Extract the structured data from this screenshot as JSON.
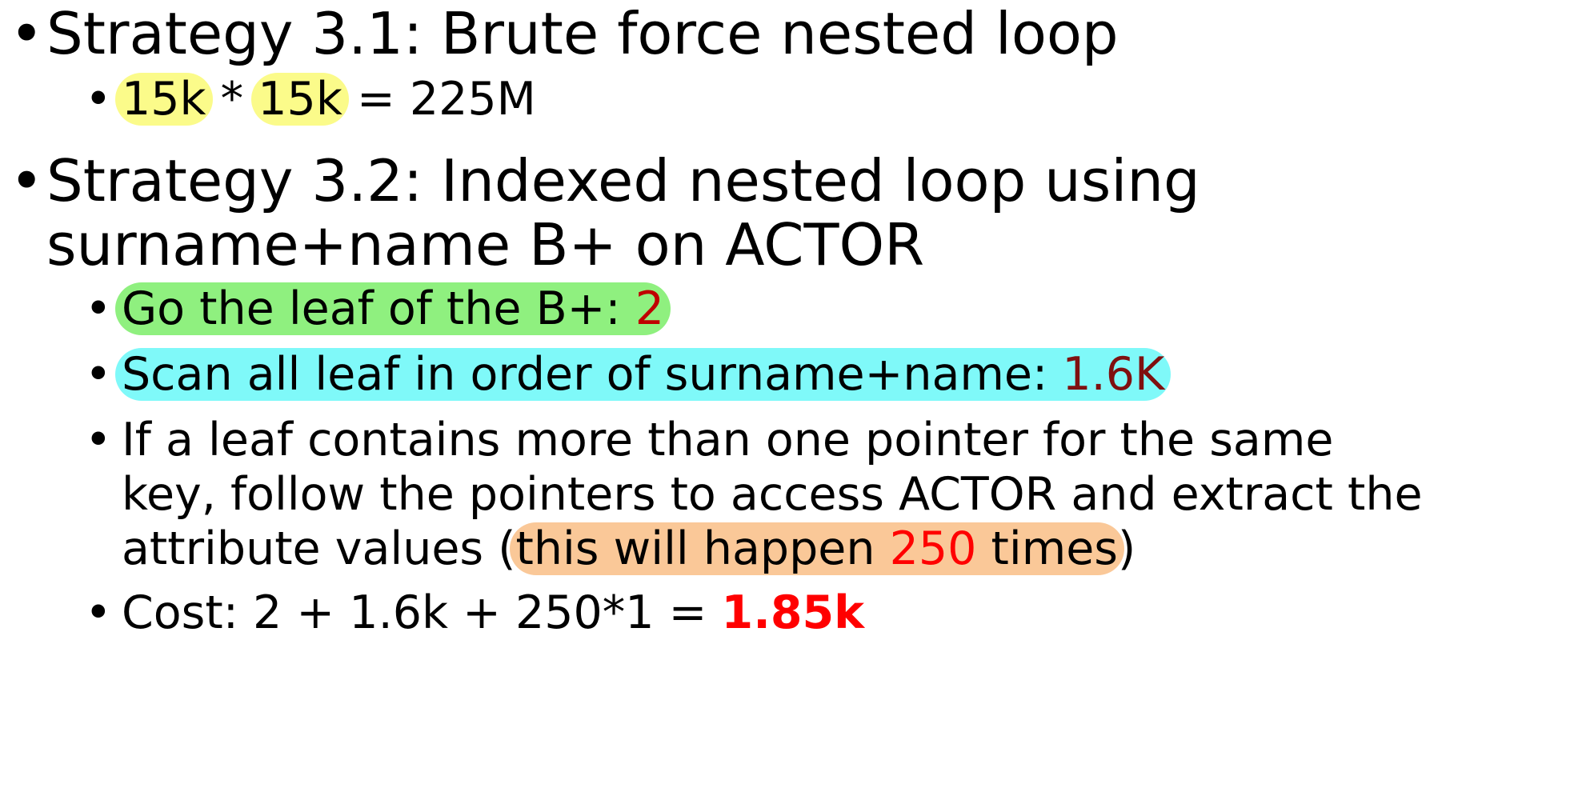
{
  "bullet_glyph": "•",
  "items": [
    {
      "level": 1,
      "text": "Strategy 3.1: Brute force nested loop",
      "children": [
        {
          "level": 2,
          "a": "15k",
          "b": " * ",
          "c": "15k",
          "d": " = 225M"
        }
      ]
    },
    {
      "level": 1,
      "line1": "Strategy 3.2: Indexed nested loop using",
      "line2": "surname+name B+ on ACTOR",
      "children": [
        {
          "level": 2,
          "text": "Go the leaf of the B+: ",
          "value": "2"
        },
        {
          "level": 2,
          "text": "Scan all leaf in order of surname+name: ",
          "value": "1.6K"
        },
        {
          "level": 2,
          "line1": "If a leaf contains more than one pointer for the same",
          "line2": "key, follow the pointers to access ACTOR and extract the",
          "line3_pre": "attribute values (",
          "line3_hl1": "this will happen ",
          "line3_value": "250",
          "line3_hl2": " times",
          "line3_post": ")"
        },
        {
          "level": 2,
          "text": "Cost: 2 + 1.6k + 250*1 = ",
          "value": "1.85k"
        }
      ]
    }
  ],
  "colors": {
    "highlight_yellow": "#fbfb8a",
    "highlight_green": "#8ff07f",
    "highlight_cyan": "#7ff9f9",
    "highlight_orange": "#fac898",
    "value_red": "#c00000",
    "cost_red": "#ff0000"
  }
}
